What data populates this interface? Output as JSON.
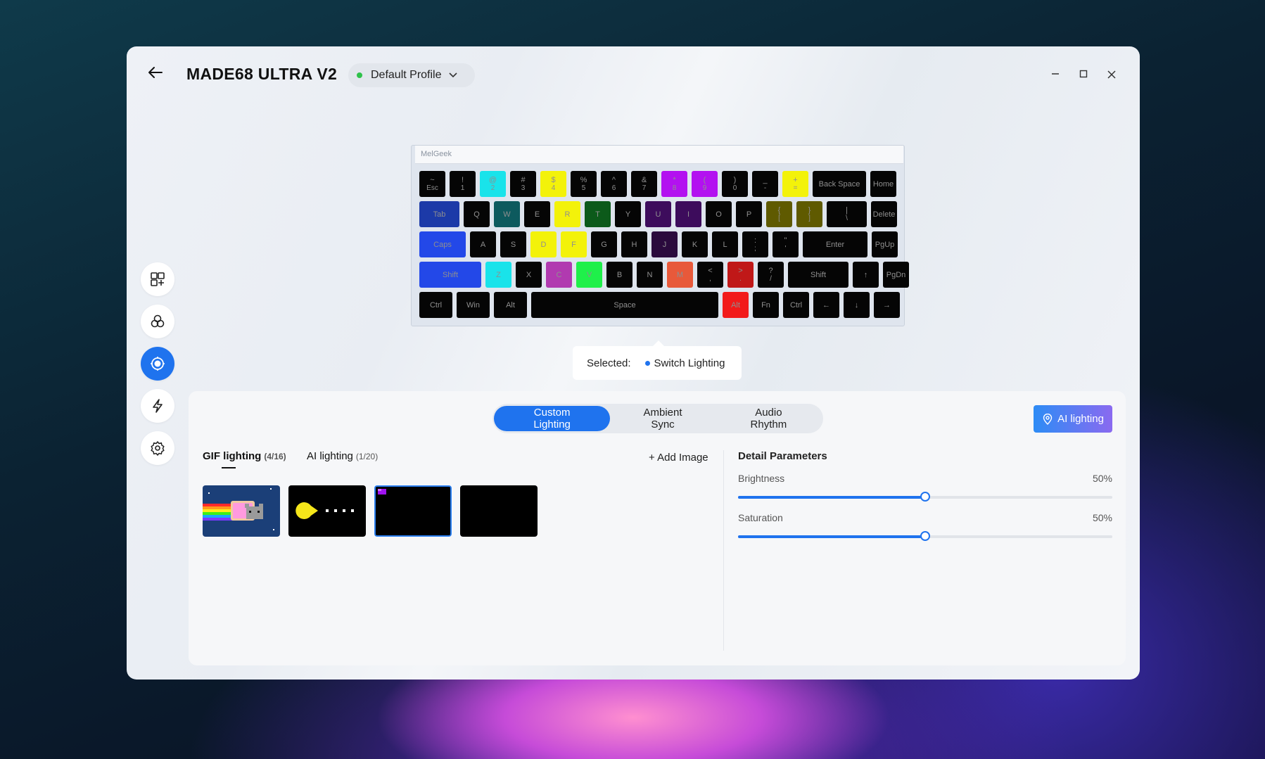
{
  "header": {
    "back_icon": "arrow-left-icon",
    "device_title": "MADE68 ULTRA V2",
    "profile": {
      "label": "Default Profile",
      "status_color": "#2ec24a"
    },
    "window_controls": {
      "minimize": "—",
      "maximize": "☐",
      "close": "✕"
    }
  },
  "sidebar": {
    "items": [
      {
        "icon": "grid-layout-icon",
        "active": false
      },
      {
        "icon": "circles-icon",
        "active": false
      },
      {
        "icon": "lighting-icon",
        "active": true
      },
      {
        "icon": "lightning-icon",
        "active": false
      },
      {
        "icon": "gear-icon",
        "active": false
      }
    ]
  },
  "keyboard": {
    "brand": "MelGeek",
    "rows": [
      [
        {
          "top": "~",
          "bottom": "Esc",
          "color": "#050505"
        },
        {
          "top": "!",
          "bottom": "1",
          "color": "#050505"
        },
        {
          "top": "@",
          "bottom": "2",
          "color": "#19e3ea"
        },
        {
          "top": "#",
          "bottom": "3",
          "color": "#050505"
        },
        {
          "top": "$",
          "bottom": "4",
          "color": "#f3f20a"
        },
        {
          "top": "%",
          "bottom": "5",
          "color": "#050505"
        },
        {
          "top": "^",
          "bottom": "6",
          "color": "#050505"
        },
        {
          "top": "&",
          "bottom": "7",
          "color": "#050505"
        },
        {
          "top": "*",
          "bottom": "8",
          "color": "#b311f0"
        },
        {
          "top": "(",
          "bottom": "9",
          "color": "#b311f0"
        },
        {
          "top": ")",
          "bottom": "0",
          "color": "#050505"
        },
        {
          "top": "_",
          "bottom": "-",
          "color": "#050505"
        },
        {
          "top": "+",
          "bottom": "=",
          "color": "#f3f20a"
        },
        {
          "top": "Back Space",
          "bottom": "",
          "color": "#050505"
        },
        {
          "top": "Home",
          "bottom": "",
          "color": "#050505"
        }
      ],
      [
        {
          "top": "Tab",
          "bottom": "",
          "color": "#1c3aa8"
        },
        {
          "top": "Q",
          "bottom": "",
          "color": "#050505"
        },
        {
          "top": "W",
          "bottom": "",
          "color": "#0d5a5e"
        },
        {
          "top": "E",
          "bottom": "",
          "color": "#050505"
        },
        {
          "top": "R",
          "bottom": "",
          "color": "#f3f20a"
        },
        {
          "top": "T",
          "bottom": "",
          "color": "#0c5a1a"
        },
        {
          "top": "Y",
          "bottom": "",
          "color": "#050505"
        },
        {
          "top": "U",
          "bottom": "",
          "color": "#3d0c5c"
        },
        {
          "top": "I",
          "bottom": "",
          "color": "#3d0c5c"
        },
        {
          "top": "O",
          "bottom": "",
          "color": "#050505"
        },
        {
          "top": "P",
          "bottom": "",
          "color": "#050505"
        },
        {
          "top": "{",
          "bottom": "[",
          "color": "#5f5a00"
        },
        {
          "top": "}",
          "bottom": "]",
          "color": "#5f5a00"
        },
        {
          "top": "|",
          "bottom": "\\",
          "color": "#050505"
        },
        {
          "top": "Delete",
          "bottom": "",
          "color": "#050505"
        }
      ],
      [
        {
          "top": "Caps",
          "bottom": "",
          "color": "#2348e8"
        },
        {
          "top": "A",
          "bottom": "",
          "color": "#050505"
        },
        {
          "top": "S",
          "bottom": "",
          "color": "#050505"
        },
        {
          "top": "D",
          "bottom": "",
          "color": "#f3f20a"
        },
        {
          "top": "F",
          "bottom": "",
          "color": "#f3f20a"
        },
        {
          "top": "G",
          "bottom": "",
          "color": "#050505"
        },
        {
          "top": "H",
          "bottom": "",
          "color": "#050505"
        },
        {
          "top": "J",
          "bottom": "",
          "color": "#2a0a3d"
        },
        {
          "top": "K",
          "bottom": "",
          "color": "#050505"
        },
        {
          "top": "L",
          "bottom": "",
          "color": "#050505"
        },
        {
          "top": ":",
          "bottom": ";",
          "color": "#050505"
        },
        {
          "top": "\"",
          "bottom": "'",
          "color": "#050505"
        },
        {
          "top": "Enter",
          "bottom": "",
          "color": "#050505"
        },
        {
          "top": "PgUp",
          "bottom": "",
          "color": "#050505"
        }
      ],
      [
        {
          "top": "Shift",
          "bottom": "",
          "color": "#2348e8"
        },
        {
          "top": "Z",
          "bottom": "",
          "color": "#19e3ea"
        },
        {
          "top": "X",
          "bottom": "",
          "color": "#050505"
        },
        {
          "top": "C",
          "bottom": "",
          "color": "#b13ab0"
        },
        {
          "top": "V",
          "bottom": "",
          "color": "#1ff04a"
        },
        {
          "top": "B",
          "bottom": "",
          "color": "#050505"
        },
        {
          "top": "N",
          "bottom": "",
          "color": "#050505"
        },
        {
          "top": "M",
          "bottom": "",
          "color": "#e8593a"
        },
        {
          "top": "<",
          "bottom": ",",
          "color": "#050505"
        },
        {
          "top": ">",
          "bottom": ".",
          "color": "#c01818"
        },
        {
          "top": "?",
          "bottom": "/",
          "color": "#050505"
        },
        {
          "top": "Shift",
          "bottom": "",
          "color": "#050505"
        },
        {
          "top": "↑",
          "bottom": "",
          "color": "#050505"
        },
        {
          "top": "PgDn",
          "bottom": "",
          "color": "#050505"
        }
      ],
      [
        {
          "top": "Ctrl",
          "bottom": "",
          "color": "#050505"
        },
        {
          "top": "Win",
          "bottom": "",
          "color": "#050505"
        },
        {
          "top": "Alt",
          "bottom": "",
          "color": "#050505"
        },
        {
          "top": "Space",
          "bottom": "",
          "color": "#050505"
        },
        {
          "top": "Alt",
          "bottom": "",
          "color": "#f21a1a"
        },
        {
          "top": "Fn",
          "bottom": "",
          "color": "#050505"
        },
        {
          "top": "Ctrl",
          "bottom": "",
          "color": "#050505"
        },
        {
          "top": "←",
          "bottom": "",
          "color": "#050505"
        },
        {
          "top": "↓",
          "bottom": "",
          "color": "#050505"
        },
        {
          "top": "→",
          "bottom": "",
          "color": "#050505"
        }
      ]
    ]
  },
  "selection": {
    "label": "Selected:",
    "value": "Switch Lighting"
  },
  "tabs": [
    {
      "label": "Custom Lighting",
      "active": true
    },
    {
      "label": "Ambient Sync",
      "active": false
    },
    {
      "label": "Audio Rhythm",
      "active": false
    }
  ],
  "ai_button": {
    "label": "AI lighting",
    "icon": "map-pin-icon"
  },
  "lighting_tabs": {
    "gif": {
      "label": "GIF lighting",
      "count": "(4/16)"
    },
    "ai": {
      "label": "AI lighting",
      "count": "(1/20)"
    },
    "add_image": "+ Add Image"
  },
  "gif_thumbs": [
    {
      "name": "nyan-cat",
      "selected": false
    },
    {
      "name": "pacman",
      "selected": false
    },
    {
      "name": "purple-corner",
      "selected": true
    },
    {
      "name": "blank",
      "selected": false
    }
  ],
  "detail": {
    "title": "Detail Parameters",
    "brightness": {
      "label": "Brightness",
      "value": "50%",
      "fraction": 0.5
    },
    "saturation": {
      "label": "Saturation",
      "value": "50%",
      "fraction": 0.5
    }
  }
}
